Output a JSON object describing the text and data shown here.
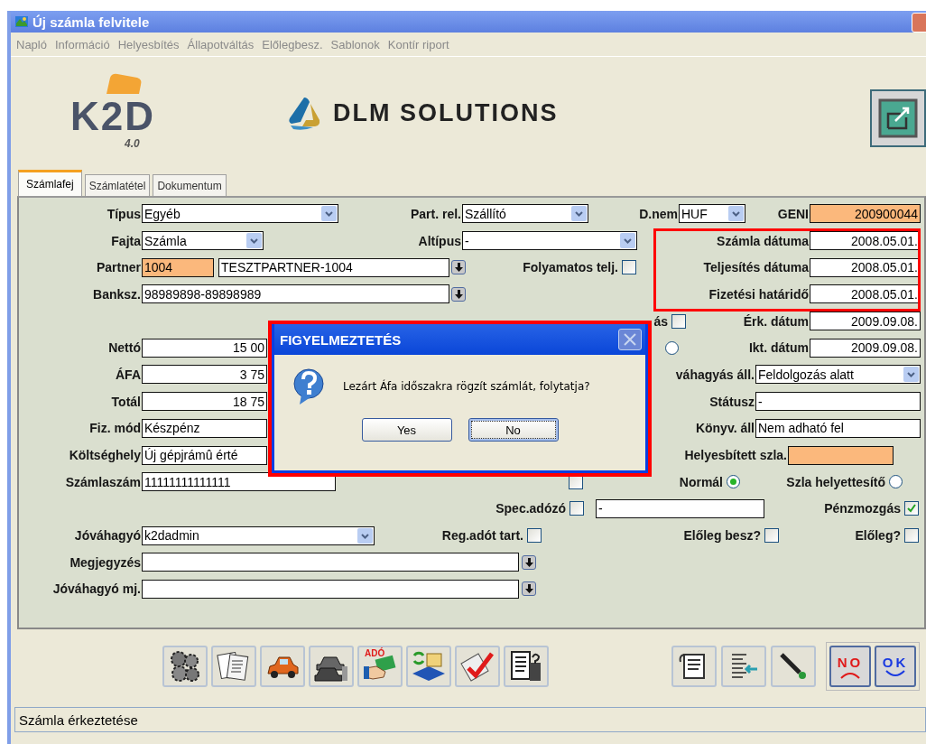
{
  "window": {
    "title": "Új számla felvitele"
  },
  "menu": [
    "Napló",
    "Információ",
    "Helyesbítés",
    "Állapotváltás",
    "Előlegbesz.",
    "Sablonok",
    "Kontír riport"
  ],
  "logo": {
    "name": "K2D",
    "version": "4.0"
  },
  "company": "DLM SOLUTIONS",
  "tabs": [
    {
      "label": "Számlafej",
      "selected": true
    },
    {
      "label": "Számlatétel",
      "selected": false
    },
    {
      "label": "Dokumentum",
      "selected": false
    }
  ],
  "form_rows": [
    [
      {
        "kind": "select",
        "label": "Típus",
        "value": "Egyéb"
      },
      {
        "kind": "select",
        "label": "Part. rel.",
        "value": "Szállító"
      },
      {
        "kind": "select",
        "label": "D.nem",
        "value": "HUF"
      },
      {
        "kind": "field",
        "label": "GENI",
        "value": "200900044",
        "highlighted": true
      }
    ],
    [
      {
        "kind": "select",
        "label": "Fajta",
        "value": "Számla"
      },
      {
        "kind": "select",
        "label": "Altípus",
        "value": "-"
      },
      {
        "kind": "field",
        "label": "Számla dátuma",
        "value": "2008.05.01.",
        "highlighted": false
      }
    ],
    [
      {
        "kind": "field",
        "label": "Partner",
        "value": "1004",
        "highlighted": true
      },
      {
        "kind": "field",
        "value": "TESZTPARTNER-1004",
        "highlighted": false
      },
      {
        "kind": "lookup"
      },
      {
        "kind": "check",
        "label": "Folyamatos telj.",
        "checked": false
      },
      {
        "kind": "field",
        "label": "Teljesítés dátuma",
        "value": "2008.05.01.",
        "highlighted": false
      }
    ],
    [
      {
        "kind": "field",
        "label": "Banksz.",
        "value": "98989898-89898989",
        "highlighted": false
      },
      {
        "kind": "lookup"
      },
      {
        "kind": "field",
        "label": "Fizetési határidő",
        "value": "2008.05.01.",
        "highlighted": false
      }
    ],
    [
      {
        "kind": "check",
        "label": "ás",
        "checked": false
      },
      {
        "kind": "field",
        "label": "Érk. dátum",
        "value": "2009.09.08.",
        "highlighted": false
      }
    ],
    [
      {
        "kind": "field",
        "label": "Nettó",
        "value": "15 00",
        "highlighted": false
      },
      {
        "kind": "radio",
        "selected": false
      },
      {
        "kind": "field",
        "label": "Ikt. dátum",
        "value": "2009.09.08.",
        "highlighted": false
      }
    ],
    [
      {
        "kind": "field",
        "label": "ÁFA",
        "value": "3 75",
        "highlighted": false
      },
      {
        "kind": "select",
        "label": "váhagyás áll.",
        "value": "Feldolgozás alatt"
      }
    ],
    [
      {
        "kind": "field",
        "label": "Totál",
        "value": "18 75",
        "highlighted": false
      },
      {
        "kind": "field",
        "label": "Státusz",
        "value": "-",
        "highlighted": false
      }
    ],
    [
      {
        "kind": "field",
        "label": "Fiz. mód",
        "value": "Készpénz",
        "highlighted": false
      },
      {
        "kind": "field",
        "label": "Könyv. áll",
        "value": "Nem adható fel",
        "highlighted": false
      }
    ],
    [
      {
        "kind": "field",
        "label": "Költséghely",
        "value": "Új gépjrámû érté",
        "highlighted": false
      },
      {
        "kind": "field",
        "label": "Helyesbített szla.",
        "highlighted": true
      }
    ],
    [
      {
        "kind": "field",
        "label": "Számlaszám",
        "value": "11111111111111",
        "highlighted": false
      },
      {
        "kind": "check",
        "checked": false
      },
      {
        "kind": "radio",
        "label": "Normál",
        "selected": true
      },
      {
        "kind": "radio",
        "label": "Szla helyettesítő",
        "selected": false
      }
    ],
    [
      {
        "kind": "check",
        "label": "Spec.adózó",
        "checked": false
      },
      {
        "kind": "field",
        "value": "-",
        "highlighted": false
      },
      {
        "kind": "check",
        "label": "Pénzmozgás",
        "checked": true
      }
    ],
    [
      {
        "kind": "select",
        "label": "Jóváhagyó",
        "value": "k2dadmin"
      },
      {
        "kind": "check",
        "label": "Reg.adót tart.",
        "checked": false
      },
      {
        "kind": "check",
        "label": "Előleg besz?",
        "checked": false
      },
      {
        "kind": "check",
        "label": "Előleg?",
        "checked": false
      }
    ],
    [
      {
        "kind": "field",
        "label": "Megjegyzés",
        "highlighted": false
      },
      {
        "kind": "lookup"
      }
    ],
    [
      {
        "kind": "field",
        "label": "Jóváhagyó mj.",
        "highlighted": false
      },
      {
        "kind": "lookup"
      }
    ]
  ],
  "dates_marked": true,
  "dialog": {
    "title": "FIGYELMEZTETÉS",
    "message": "Lezárt Áfa időszakra rögzít számlát, folytatja?",
    "marked": true,
    "buttons": [
      {
        "label": "Yes",
        "focused": false
      },
      {
        "label": "No",
        "focused": true
      }
    ]
  },
  "toolbar_left": [
    {
      "kind": "gears"
    },
    {
      "kind": "documents"
    },
    {
      "kind": "car"
    },
    {
      "kind": "cars"
    },
    {
      "kind": "tax-hand",
      "text": "ADÓ"
    },
    {
      "kind": "folders"
    },
    {
      "kind": "checkmark"
    },
    {
      "kind": "doc-question"
    }
  ],
  "toolbar_right": [
    {
      "kind": "note"
    },
    {
      "kind": "list-arrow"
    },
    {
      "kind": "pen"
    }
  ],
  "confirm_buttons": [
    {
      "kind": "no",
      "label": "NO"
    },
    {
      "kind": "ok",
      "label": "OK"
    }
  ],
  "status_bar": "Számla érkeztetése"
}
